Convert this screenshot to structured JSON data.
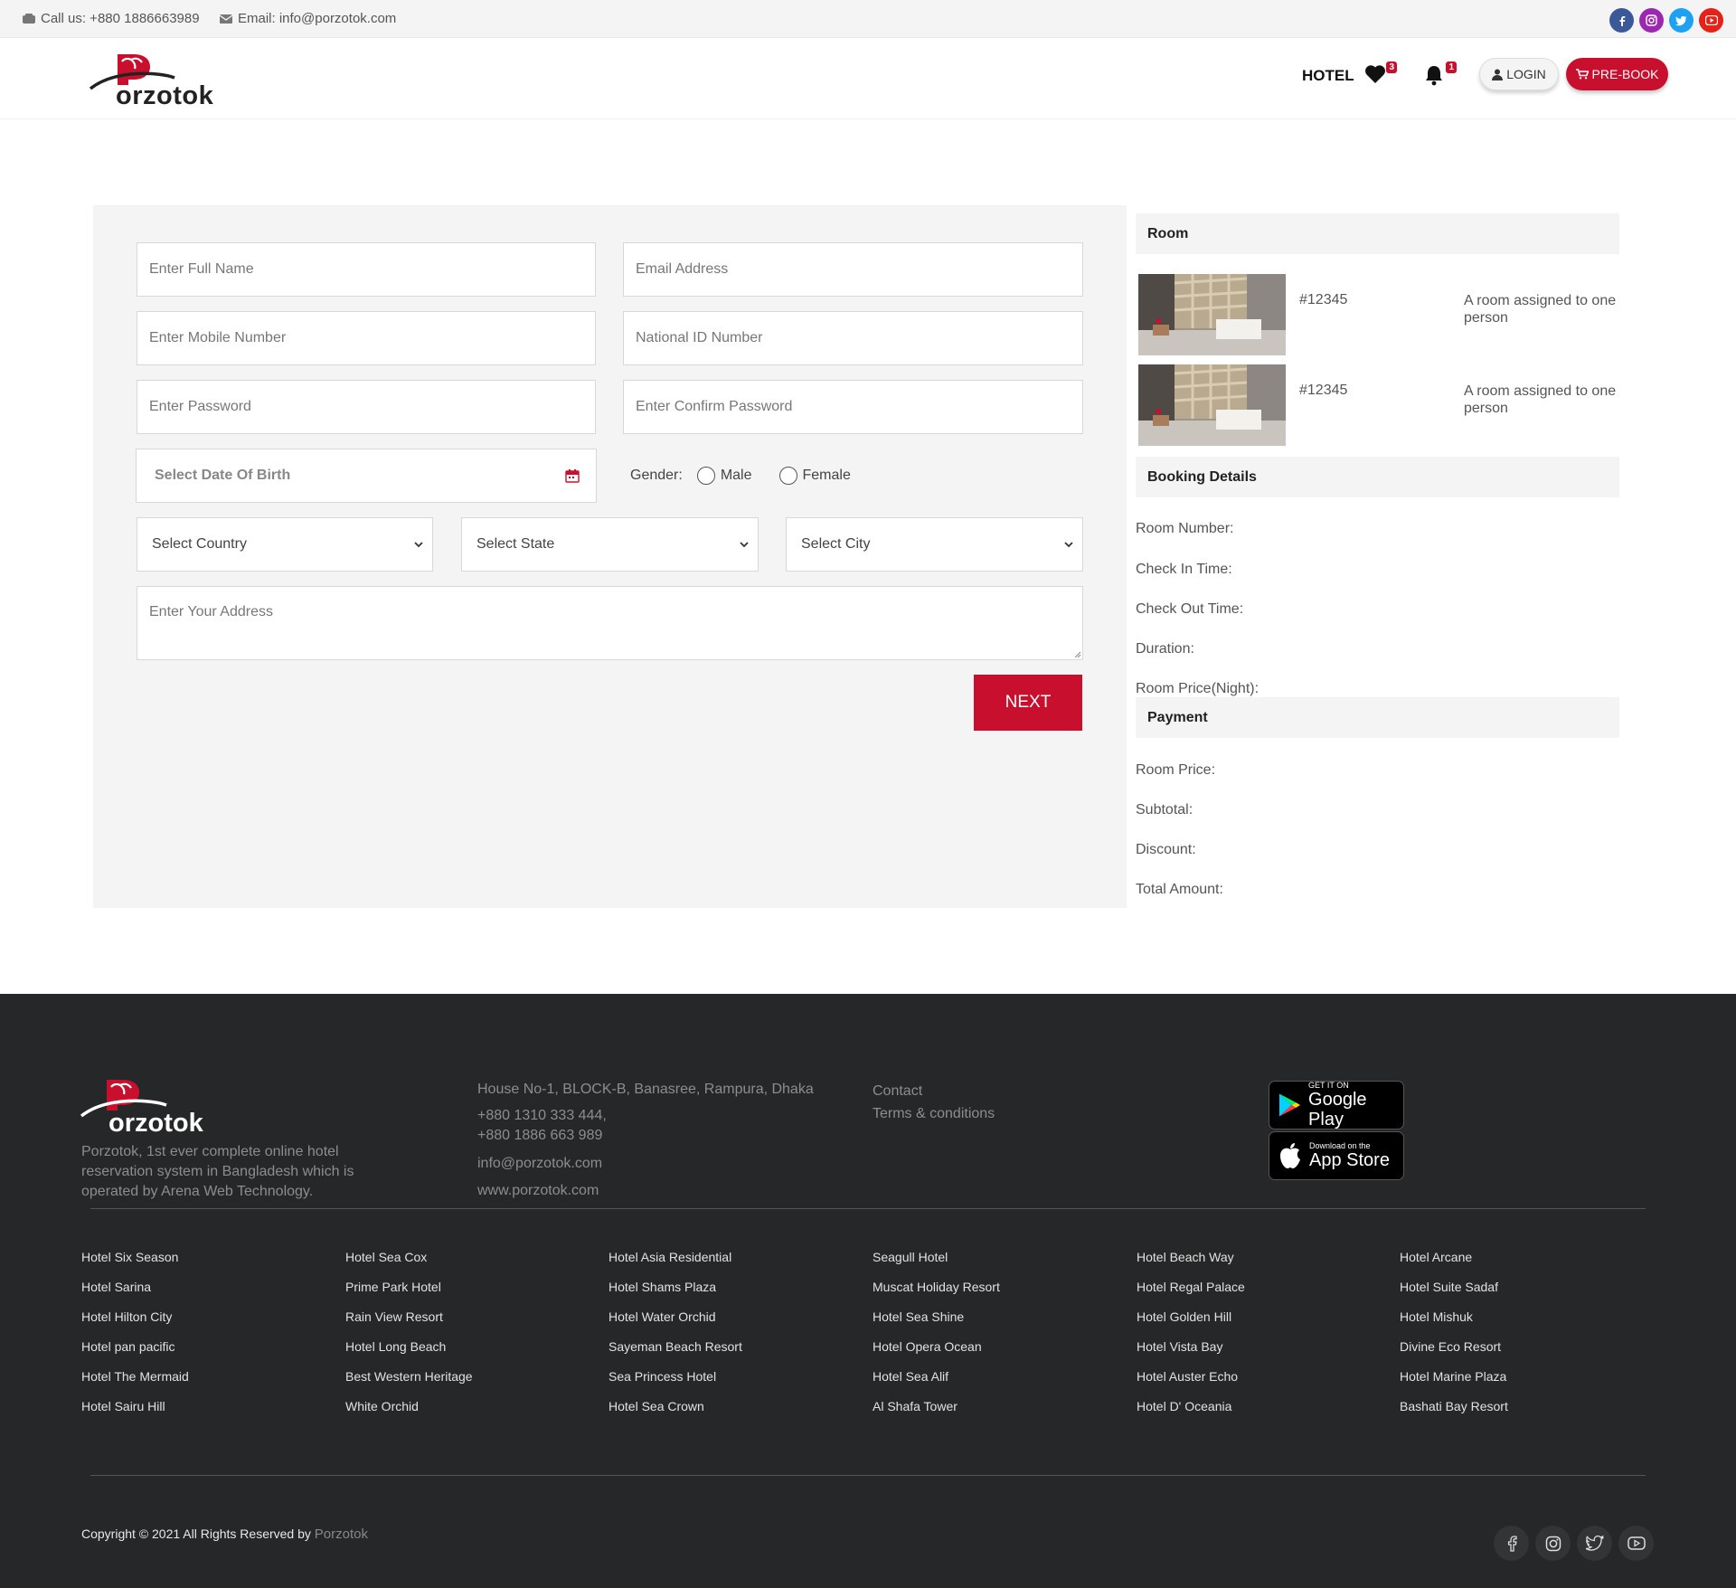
{
  "topbar": {
    "phone": "Call us: +880 1886663989",
    "email": "Email: info@porzotok.com",
    "social": [
      {
        "icon": "facebook-icon",
        "color": "#3b5998"
      },
      {
        "icon": "instagram-icon",
        "color": "#9c27b0"
      },
      {
        "icon": "twitter-icon",
        "color": "#1da1f2"
      },
      {
        "icon": "youtube-icon",
        "color": "#e62117"
      }
    ]
  },
  "header": {
    "logo_text": "orzotok",
    "nav_hotel": "HOTEL",
    "wishlist_count": "3",
    "notification_count": "1",
    "login_label": "LOGIN",
    "prebook_label": "PRE-BOOK"
  },
  "form": {
    "full_name_placeholder": "Enter Full Name",
    "email_placeholder": "Email Address",
    "mobile_placeholder": "Enter Mobile Number",
    "nid_placeholder": "National ID Number",
    "password_placeholder": "Enter Password",
    "confirm_password_placeholder": "Enter Confirm Password",
    "dob_placeholder": "Select Date Of Birth",
    "gender_label": "Gender:",
    "gender_male": "Male",
    "gender_female": "Female",
    "country_select": "Select Country",
    "state_select": "Select State",
    "city_select": "Select City",
    "address_placeholder": "Enter Your Address",
    "next_label": "NEXT"
  },
  "summary": {
    "room_heading": "Room",
    "rooms": [
      {
        "id": "#12345",
        "desc": "A room assigned to one person"
      },
      {
        "id": "#12345",
        "desc": "A room assigned to one person"
      }
    ],
    "booking_heading": "Booking Details",
    "booking_labels": [
      "Room Number:",
      "Check In Time:",
      "Check Out Time:",
      "Duration:",
      "Room Price(Night):"
    ],
    "payment_heading": "Payment",
    "payment_labels": [
      "Room Price:",
      "Subtotal:",
      "Discount:",
      "Total Amount:"
    ]
  },
  "footer": {
    "logo_text": "orzotok",
    "about": "Porzotok, 1st ever complete online hotel reservation system in Bangladesh which is operated by Arena Web Technology.",
    "address": "House No-1, BLOCK-B, Banasree, Rampura, Dhaka",
    "phone1": "+880 1310 333 444,",
    "phone2": "+880 1886 663 989",
    "email": "info@porzotok.com",
    "website": "www.porzotok.com",
    "link_contact": "Contact",
    "link_terms": "Terms & conditions",
    "google_play_small": "GET IT ON",
    "google_play_big": "Google Play",
    "app_store_small": "Download on the",
    "app_store_big": "App Store",
    "hotel_columns": [
      [
        "Hotel Six Season",
        "Hotel Sarina",
        "Hotel Hilton City",
        "Hotel pan pacific",
        "Hotel The Mermaid",
        "Hotel Sairu Hill"
      ],
      [
        "Hotel Sea Cox",
        "Prime Park Hotel",
        "Rain View Resort",
        "Hotel Long Beach",
        "Best Western Heritage",
        "White Orchid"
      ],
      [
        "Hotel Asia Residential",
        "Hotel Shams Plaza",
        "Hotel Water Orchid",
        "Sayeman Beach Resort",
        "Sea Princess Hotel",
        "Hotel Sea Crown"
      ],
      [
        "Seagull Hotel",
        "Muscat Holiday Resort",
        "Hotel Sea Shine",
        "Hotel Opera Ocean",
        "Hotel Sea Alif",
        "Al Shafa Tower"
      ],
      [
        "Hotel Beach Way",
        "Hotel Regal Palace",
        "Hotel Golden Hill",
        "Hotel Vista Bay",
        "Hotel Auster Echo",
        "Hotel D' Oceania"
      ],
      [
        "Hotel Arcane",
        "Hotel Suite Sadaf",
        "Hotel Mishuk",
        "Divine Eco Resort",
        "Hotel Marine Plaza",
        "Bashati Bay Resort"
      ]
    ],
    "copyright": "Copyright © 2021 All Rights Reserved by",
    "copyright_brand": "Porzotok",
    "social": [
      "facebook-icon",
      "instagram-icon",
      "twitter-icon",
      "youtube-icon"
    ]
  },
  "colors": {
    "brand": "#c8102e",
    "panel": "#f4f4f4",
    "footer": "#262729"
  }
}
